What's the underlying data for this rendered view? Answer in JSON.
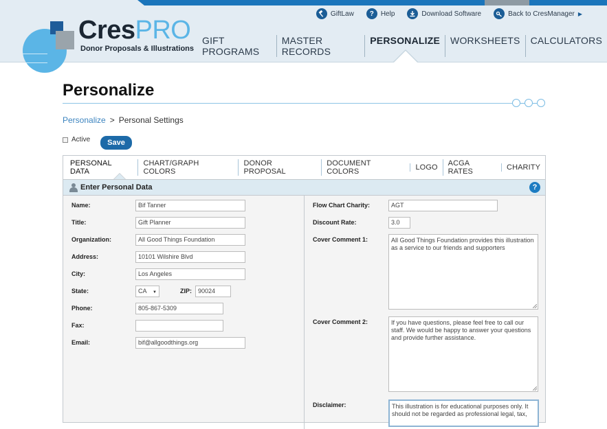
{
  "header": {
    "brand_main": "Cres",
    "brand_accent": "PRO",
    "tagline": "Donor Proposals & Illustrations",
    "toplinks": [
      {
        "label": "GiftLaw",
        "icon": "gavel-icon"
      },
      {
        "label": "Help",
        "icon": "help-icon"
      },
      {
        "label": "Download Software",
        "icon": "download-icon"
      },
      {
        "label": "Back to CresManager",
        "icon": "key-icon"
      }
    ],
    "nav": [
      "GIFT PROGRAMS",
      "MASTER RECORDS",
      "PERSONALIZE",
      "WORKSHEETS",
      "CALCULATORS"
    ],
    "active_nav": "PERSONALIZE"
  },
  "page": {
    "title": "Personalize",
    "breadcrumb_link": "Personalize",
    "breadcrumb_sep": ">",
    "breadcrumb_current": "Personal Settings",
    "active_label": "Active",
    "save_label": "Save"
  },
  "tabs": [
    "PERSONAL DATA",
    "CHART/GRAPH COLORS",
    "DONOR PROPOSAL",
    "DOCUMENT COLORS",
    "LOGO",
    "ACGA RATES",
    "CHARITY"
  ],
  "section": {
    "title": "Enter Personal Data",
    "help": "?"
  },
  "form": {
    "name_label": "Name:",
    "name": "Bif Tanner",
    "title_label": "Title:",
    "title": "Gift Planner",
    "org_label": "Organization:",
    "org": "All Good Things Foundation",
    "address_label": "Address:",
    "address": "10101 Wilshire Blvd",
    "city_label": "City:",
    "city": "Los Angeles",
    "state_label": "State:",
    "state": "CA",
    "zip_label": "ZIP:",
    "zip": "90024",
    "phone_label": "Phone:",
    "phone": "805-867-5309",
    "fax_label": "Fax:",
    "fax": "",
    "email_label": "Email:",
    "email": "bif@allgoodthings.org",
    "flow_label": "Flow Chart Charity:",
    "flow": "AGT",
    "discount_label": "Discount Rate:",
    "discount": "3.0",
    "cover1_label": "Cover Comment 1:",
    "cover1": "All Good Things Foundation provides this illustration as a service to our friends and supporters",
    "cover2_label": "Cover Comment 2:",
    "cover2": "If you have questions, please feel free to call our staff. We would be happy to answer your questions and provide further assistance.",
    "disclaimer_label": "Disclaimer:",
    "disclaimer": "This illustration is for educational purposes only. It should not be regarded as professional legal, tax,"
  },
  "colors": {
    "brand_blue": "#1b75bb",
    "accent_light": "#5bb5e6",
    "save_button": "#1d6aa8",
    "section_bar": "#dceaf2"
  }
}
